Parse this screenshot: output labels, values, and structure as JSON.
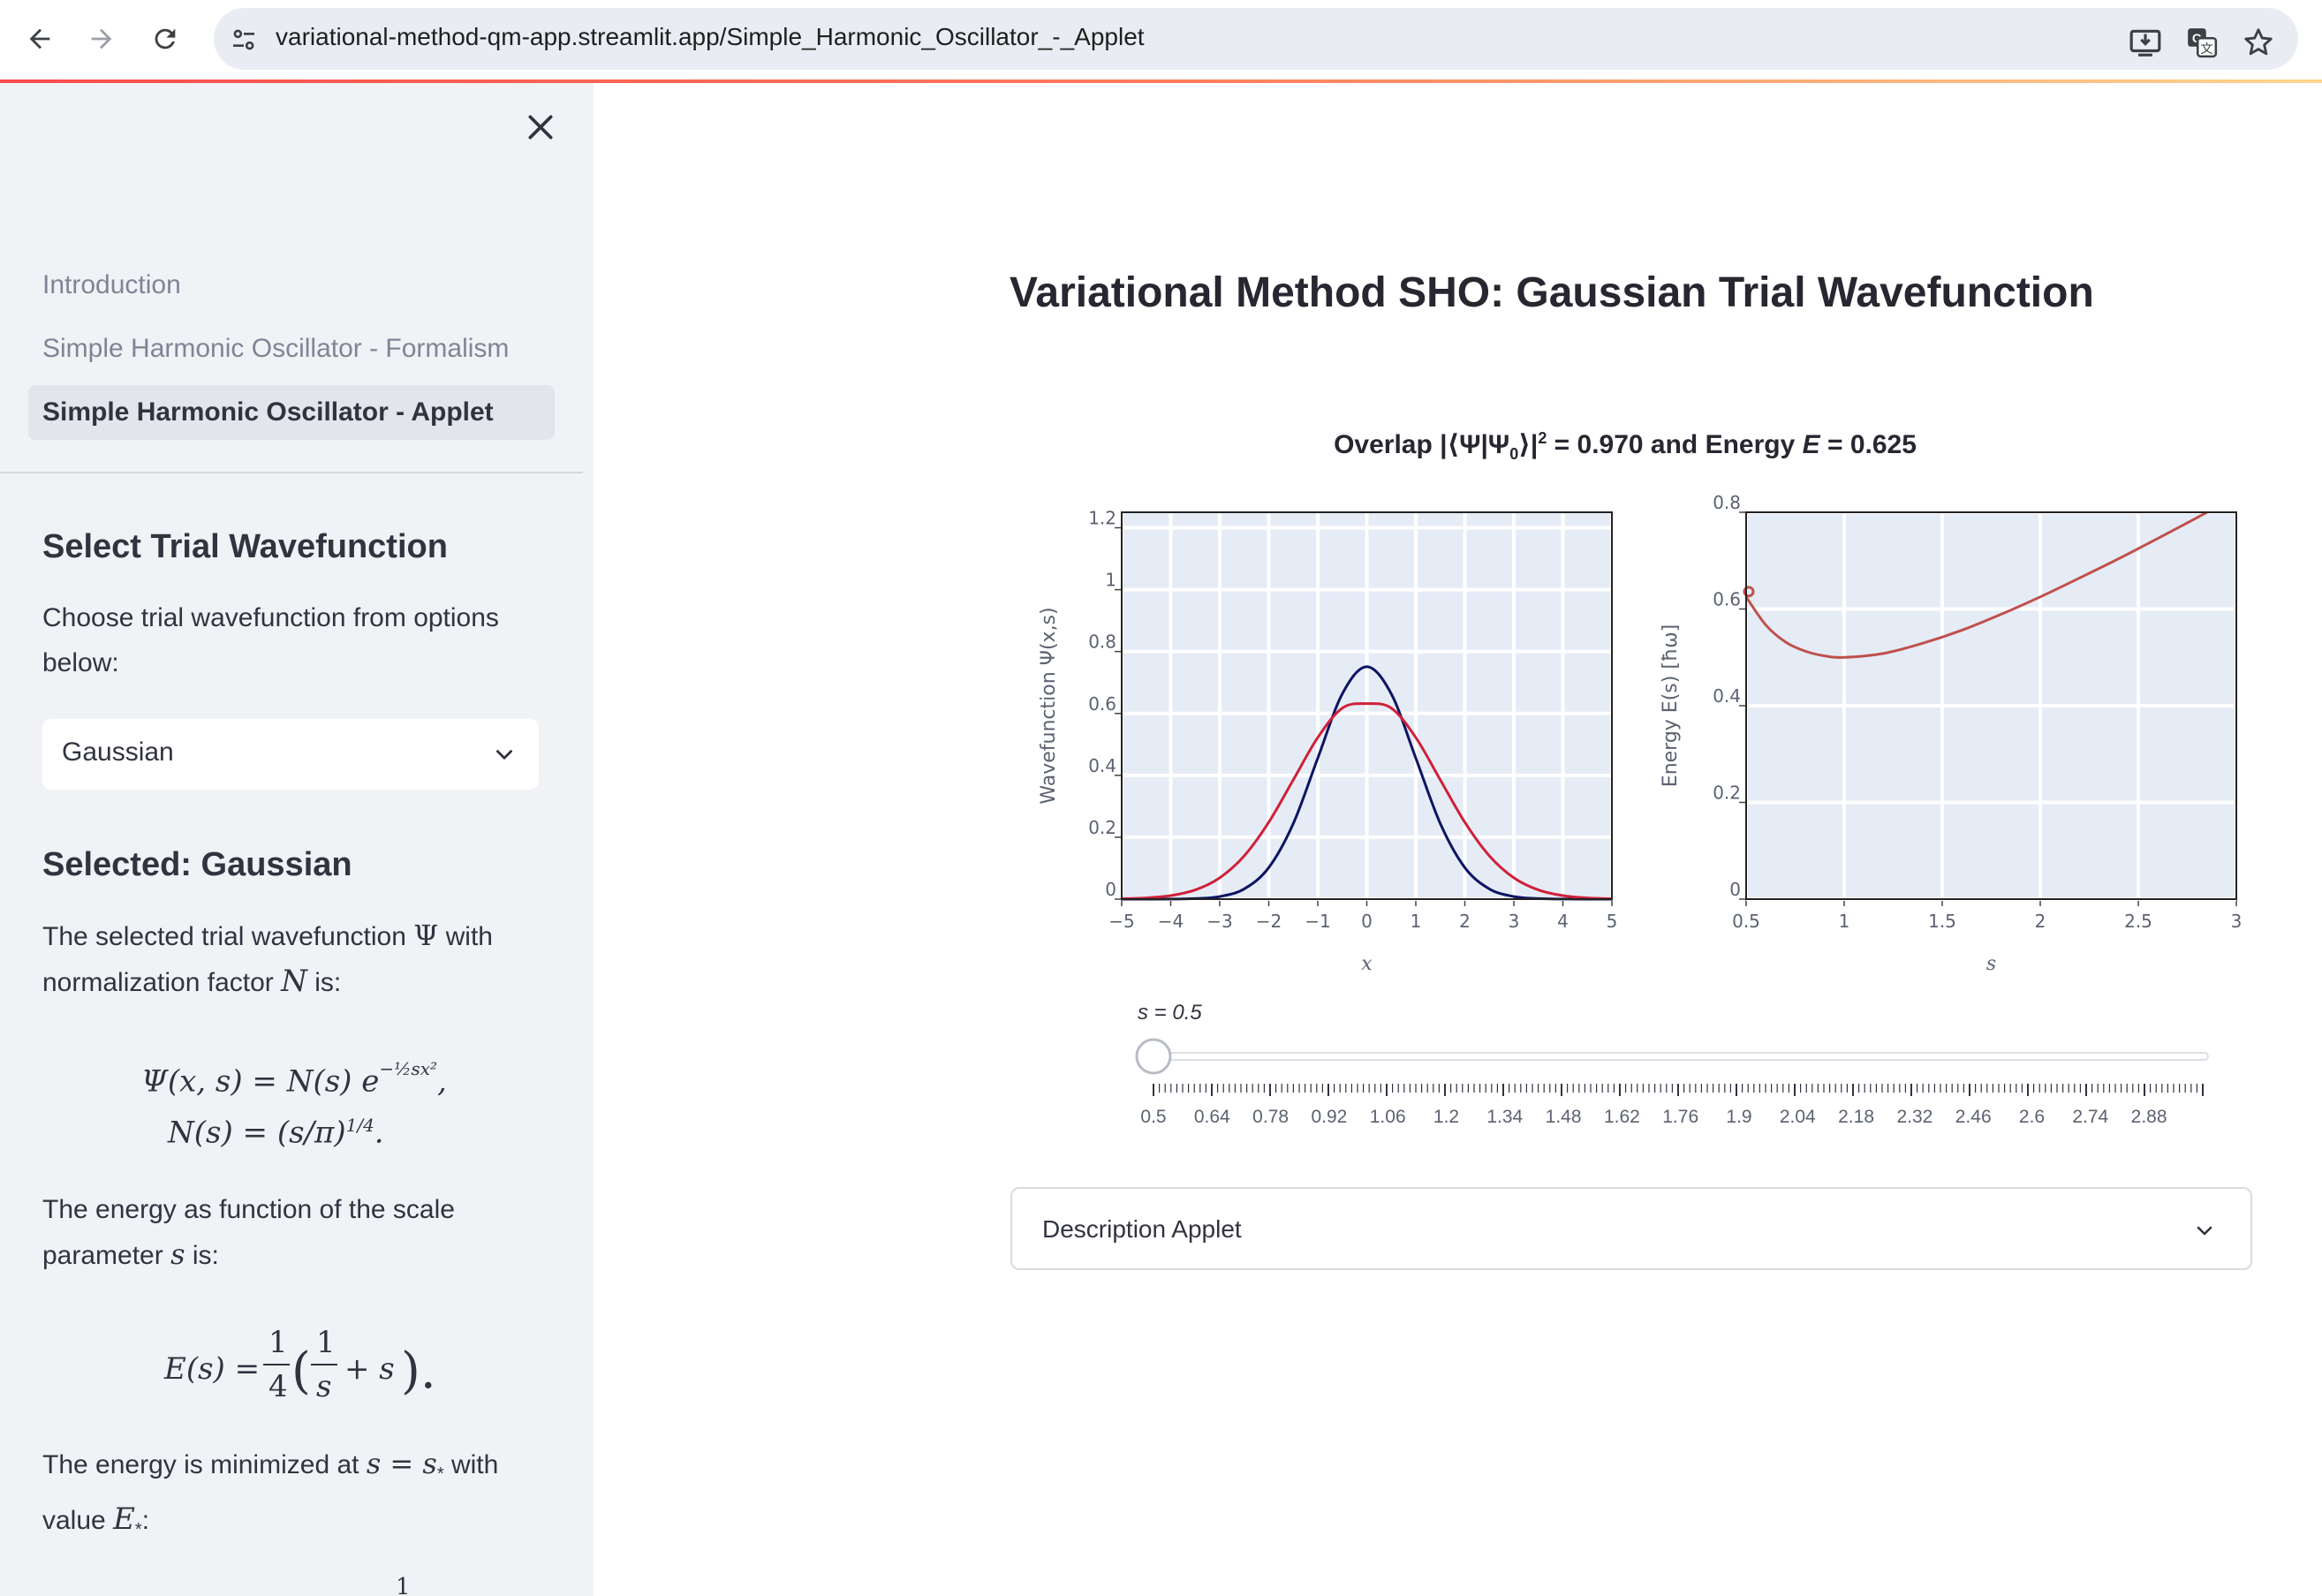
{
  "browser": {
    "url": "variational-method-qm-app.streamlit.app/Simple_Harmonic_Oscillator_-_Applet",
    "icons": [
      "back-arrow-icon",
      "forward-arrow-icon",
      "reload-icon",
      "site-settings-icon",
      "install-app-icon",
      "translate-icon",
      "bookmark-star-icon"
    ]
  },
  "sidebar": {
    "nav": [
      {
        "label": "Introduction",
        "active": false
      },
      {
        "label": "Simple Harmonic Oscillator - Formalism",
        "active": false
      },
      {
        "label": "Simple Harmonic Oscillator - Applet",
        "active": true
      }
    ],
    "select_heading": "Select Trial Wavefunction",
    "choose_text": "Choose trial wavefunction from options below:",
    "select_value": "Gaussian",
    "selected_heading": "Selected: Gaussian",
    "p1_a": "The selected trial wavefunction",
    "p1_psi": "Ψ",
    "p1_b": "with normalization factor",
    "p1_n": "N",
    "p1_c": "is:",
    "eq1_line1": "Ψ(x, s) = N(s) e",
    "eq1_exp": "−½sx²",
    "eq1_tail": ",",
    "eq1_line2": "N(s) = (s/π)",
    "eq1_line2_exp": "1/4",
    "eq1_line2_tail": ".",
    "p2_a": "The energy as function of the scale parameter",
    "p2_s": "s",
    "p2_b": "is:",
    "eq2_lhs": "E(s) =",
    "eq2_frac_num": "1",
    "eq2_frac_den": "4",
    "eq2_paren_open": "(",
    "eq2_inner_num": "1",
    "eq2_inner_den": "s",
    "eq2_plus": "+ s",
    "eq2_paren_close": ").",
    "p3_a": "The energy is minimized at",
    "p3_math": "s = s",
    "p3_sub": "*",
    "p3_b": "with value",
    "p3_e": "E",
    "p3_esub": "*",
    "p3_colon": ":",
    "eq3_partial": "1"
  },
  "main": {
    "title": "Variational Method SHO: Gaussian Trial Wavefunction",
    "fig_title_a": "Overlap |⟨Ψ|Ψ",
    "fig_title_sub": "0",
    "fig_title_b": "⟩|",
    "fig_title_sup": "2",
    "fig_title_c": " = 0.970 and Energy ",
    "fig_title_e": "E",
    "fig_title_d": " = 0.625",
    "slider_label": "s = 0.5",
    "slider_value": 0.5,
    "slider_min": 0.5,
    "slider_max": 3,
    "slider_ticks": [
      "0.5",
      "0.64",
      "0.78",
      "0.92",
      "1.06",
      "1.2",
      "1.34",
      "1.48",
      "1.62",
      "1.76",
      "1.9",
      "2.04",
      "2.18",
      "2.32",
      "2.46",
      "2.6",
      "2.74",
      "2.88"
    ],
    "expander_label": "Description Applet"
  },
  "chart_data": [
    {
      "type": "line",
      "title": "",
      "xlabel": "x",
      "ylabel": "Wavefunction Ψ(x,s)",
      "xlim": [
        -5,
        5
      ],
      "ylim": [
        0,
        1.25
      ],
      "xticks": [
        "−5",
        "−4",
        "−3",
        "−2",
        "−1",
        "0",
        "1",
        "2",
        "3",
        "4",
        "5"
      ],
      "yticks": [
        "0",
        "0.2",
        "0.4",
        "0.6",
        "0.8",
        "1",
        "1.2"
      ],
      "grid": true,
      "series": [
        {
          "formula": "exact ground state (s=1)",
          "color": "#0d1463",
          "x": [
            -5,
            -4.5,
            -4,
            -3.5,
            -3,
            -2.5,
            -2,
            -1.5,
            -1,
            -0.5,
            0,
            0.5,
            1,
            1.5,
            2,
            2.5,
            3,
            3.5,
            4,
            4.5,
            5
          ],
          "y": [
            0.0,
            0.0,
            0.0003,
            0.0017,
            0.0083,
            0.0331,
            0.1019,
            0.244,
            0.4556,
            0.6632,
            0.7511,
            0.6632,
            0.4556,
            0.244,
            0.1019,
            0.0331,
            0.0083,
            0.0017,
            0.0003,
            0.0,
            0.0
          ]
        },
        {
          "formula": "trial Gaussian s=0.5",
          "color": "#d0203a",
          "x": [
            -5,
            -4.5,
            -4,
            -3.5,
            -3,
            -2.5,
            -2,
            -1.5,
            -1,
            -0.5,
            0,
            0.5,
            1,
            1.5,
            2,
            2.5,
            3,
            3.5,
            4,
            4.5,
            5
          ],
          "y": [
            0.0012,
            0.004,
            0.0114,
            0.0297,
            0.0689,
            0.1398,
            0.2483,
            0.3853,
            0.522,
            0.6172,
            0.6316,
            0.6172,
            0.522,
            0.3853,
            0.2483,
            0.1398,
            0.0689,
            0.0297,
            0.0114,
            0.004,
            0.0012
          ]
        }
      ]
    },
    {
      "type": "line",
      "title": "",
      "xlabel": "s",
      "ylabel": "Energy E(s) [ħω]",
      "xlim": [
        0.5,
        3
      ],
      "ylim": [
        0,
        0.8
      ],
      "xticks": [
        "0.5",
        "1",
        "1.5",
        "2",
        "2.5",
        "3"
      ],
      "yticks": [
        "0",
        "0.2",
        "0.4",
        "0.6",
        "0.8"
      ],
      "grid": true,
      "marker": {
        "x": 0.5,
        "y": 0.625
      },
      "series": [
        {
          "formula": "E(s) = (1/s + s)/4",
          "color": "#c0504d",
          "x": [
            0.5,
            0.6,
            0.7,
            0.8,
            0.9,
            1.0,
            1.2,
            1.4,
            1.6,
            1.8,
            2.0,
            2.2,
            2.4,
            2.6,
            2.8,
            2.85
          ],
          "y": [
            0.625,
            0.567,
            0.532,
            0.513,
            0.503,
            0.5,
            0.508,
            0.529,
            0.556,
            0.589,
            0.625,
            0.664,
            0.704,
            0.746,
            0.789,
            0.8
          ]
        }
      ]
    }
  ]
}
